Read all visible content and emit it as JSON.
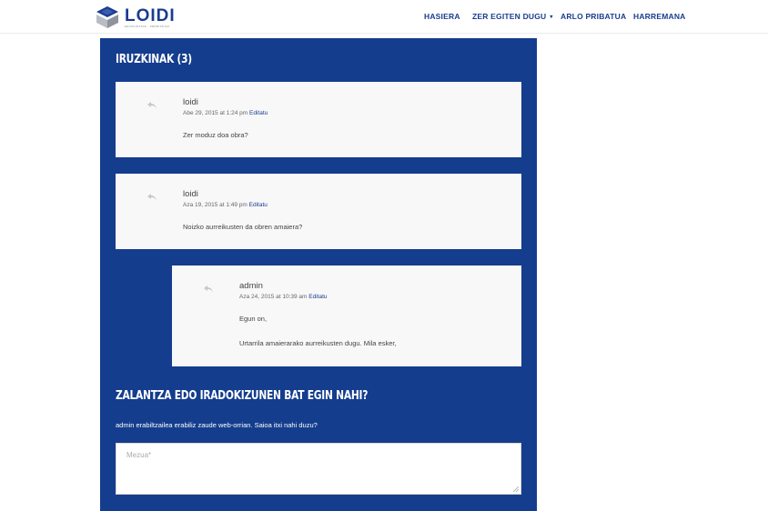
{
  "brand": {
    "name": "LOIDI",
    "tagline": "ERAIKUNTZAK · ZERBITZUAK"
  },
  "nav": {
    "items": [
      {
        "label": "HASIERA"
      },
      {
        "label": "ZER EGITEN DUGU"
      },
      {
        "label": "ARLO PRIBATUA"
      },
      {
        "label": "HARREMANA"
      }
    ]
  },
  "comments": {
    "title": "IRUZKINAK (3)",
    "items": [
      {
        "author": "loidi",
        "date": "Abe 29, 2015 at 1:24 pm",
        "edit": "Editatu",
        "text": "Zer moduz doa obra?"
      },
      {
        "author": "loidi",
        "date": "Aza 19, 2015 at 1:49 pm",
        "edit": "Editatu",
        "text": "Noizko aurreikusten da obren amaiera?"
      },
      {
        "author": "admin",
        "date": "Aza 24, 2015 at 10:39 am",
        "edit": "Editatu",
        "text": "Egun on,",
        "text2": "Urtarrila amaierarako aurreikusten dugu. Mila esker,"
      }
    ]
  },
  "reply_form": {
    "title": "ZALANTZA EDO IRADOKIZUNEN BAT EGIN NAHI?",
    "logged_in_text": "admin erabiltzailea erabiliz zaude web-orrian. Saioa itxi nahi duzu?",
    "message_placeholder": "Mezua*"
  },
  "colors": {
    "primary": "#143d8d",
    "nav_text": "#1a3c8f",
    "card_bg": "#f8f8f8"
  },
  "icons": {
    "reply": "reply-arrow-icon",
    "logo": "loidi-cube-logo",
    "caret": "chevron-down-icon"
  }
}
